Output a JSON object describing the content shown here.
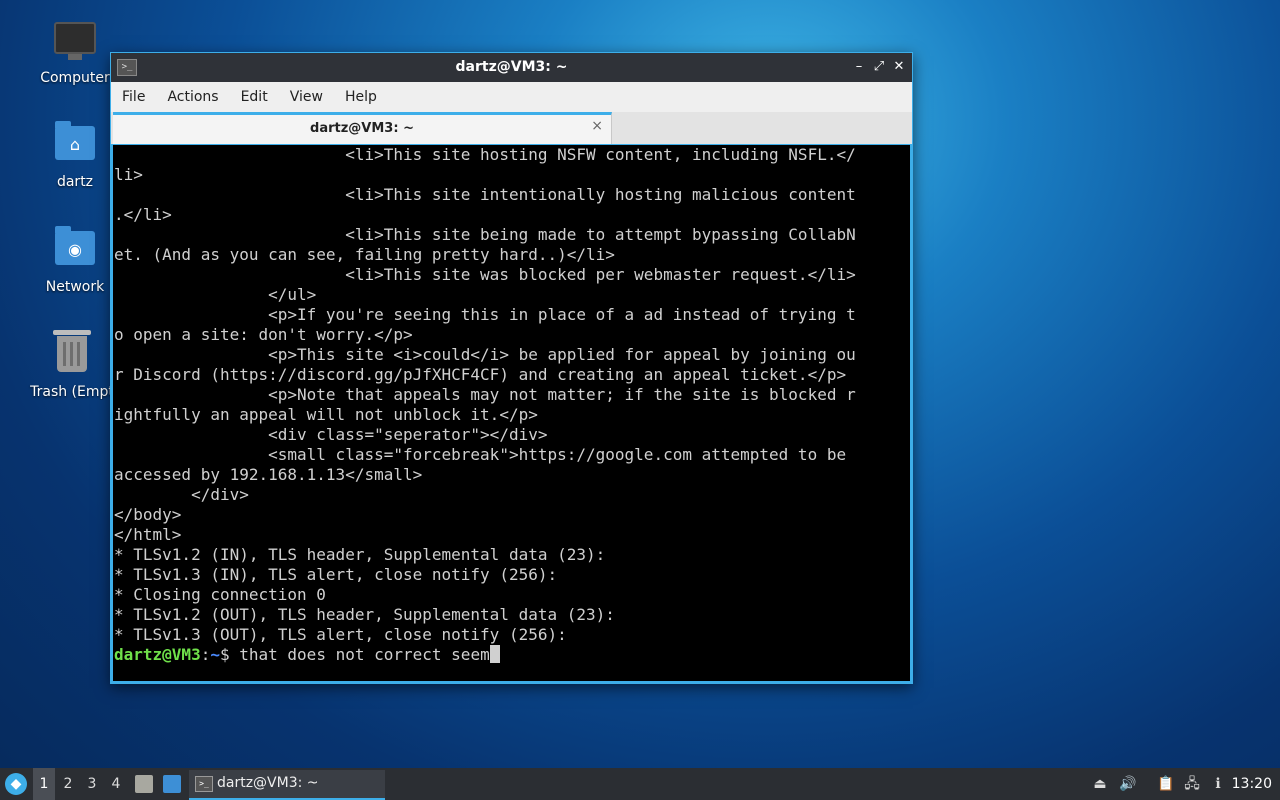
{
  "desktop": {
    "icons": [
      {
        "label": "Computer"
      },
      {
        "label": "dartz"
      },
      {
        "label": "Network"
      },
      {
        "label": "Trash (Empt"
      }
    ]
  },
  "window": {
    "title": "dartz@VM3: ~",
    "controls": {
      "minimize": "–",
      "maximize": "⤢",
      "close": "✕"
    },
    "menu": [
      "File",
      "Actions",
      "Edit",
      "View",
      "Help"
    ],
    "tab": {
      "label": "dartz@VM3: ~",
      "close": "×"
    }
  },
  "terminal": {
    "lines": [
      "                        <li>This site hosting NSFW content, including NSFL.</",
      "li>",
      "                        <li>This site intentionally hosting malicious content",
      ".</li>",
      "                        <li>This site being made to attempt bypassing CollabN",
      "et. (And as you can see, failing pretty hard..)</li>",
      "                        <li>This site was blocked per webmaster request.</li>",
      "                </ul>",
      "                <p>If you're seeing this in place of a ad instead of trying t",
      "o open a site: don't worry.</p>",
      "                <p>This site <i>could</i> be applied for appeal by joining ou",
      "r Discord (https://discord.gg/pJfXHCF4CF) and creating an appeal ticket.</p>",
      "                <p>Note that appeals may not matter; if the site is blocked r",
      "ightfully an appeal will not unblock it.</p>",
      "                <div class=\"seperator\"></div>",
      "                <small class=\"forcebreak\">https://google.com attempted to be",
      "accessed by 192.168.1.13</small>",
      "        </div>",
      "</body>",
      "</html>",
      "* TLSv1.2 (IN), TLS header, Supplemental data (23):",
      "* TLSv1.3 (IN), TLS alert, close notify (256):",
      "* Closing connection 0",
      "* TLSv1.2 (OUT), TLS header, Supplemental data (23):",
      "* TLSv1.3 (OUT), TLS alert, close notify (256):"
    ],
    "prompt": {
      "user": "dartz@VM3",
      "sep": ":",
      "path": "~",
      "symbol": "$ ",
      "input": "that does not correct seem"
    }
  },
  "taskbar": {
    "workspaces": [
      "1",
      "2",
      "3",
      "4"
    ],
    "task_label": "dartz@VM3: ~",
    "clock": "13:20"
  }
}
